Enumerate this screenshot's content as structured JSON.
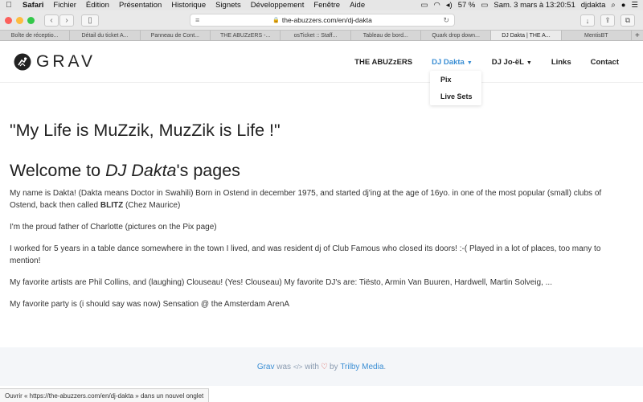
{
  "menubar": {
    "app": "Safari",
    "items": [
      "Fichier",
      "Édition",
      "Présentation",
      "Historique",
      "Signets",
      "Développement",
      "Fenêtre",
      "Aide"
    ],
    "battery": "57 %",
    "datetime": "Sam. 3 mars à  13:20:51",
    "user": "djdakta"
  },
  "browser": {
    "url": "the-abuzzers.com/en/dj-dakta",
    "tabs": [
      {
        "label": "Boîte de réceptio...",
        "active": false
      },
      {
        "label": "Détail du ticket A...",
        "active": false
      },
      {
        "label": "Panneau de Cont...",
        "active": false
      },
      {
        "label": "THE ABUZzERS -...",
        "active": false
      },
      {
        "label": "osTicket :: Staff...",
        "active": false
      },
      {
        "label": "Tableau de bord...",
        "active": false
      },
      {
        "label": "Quark drop down...",
        "active": false
      },
      {
        "label": "DJ Dakta | THE A...",
        "active": true
      },
      {
        "label": "MentisBT",
        "active": false
      }
    ],
    "status": "Ouvrir « https://the-abuzzers.com/en/dj-dakta » dans un nouvel onglet"
  },
  "site": {
    "logo": "GRAV",
    "nav": [
      {
        "label": "THE ABUZzERS",
        "active": false,
        "dropdown": false
      },
      {
        "label": "DJ Dakta",
        "active": true,
        "dropdown": true
      },
      {
        "label": "DJ Jo-ëL",
        "active": false,
        "dropdown": true
      },
      {
        "label": "Links",
        "active": false,
        "dropdown": false
      },
      {
        "label": "Contact",
        "active": false,
        "dropdown": false
      }
    ],
    "dropdown_items": [
      "Pix",
      "Live Sets"
    ]
  },
  "content": {
    "quote": "\"My Life is MuZzik, MuzZik is Life !\"",
    "welcome_prefix": "Welcome to ",
    "welcome_name": "DJ Dakta",
    "welcome_suffix": "'s pages",
    "p1_a": "My name is Dakta! (Dakta means Doctor in Swahili) Born in Ostend in december 1975, and started dj'ing at the age of 16yo. in one of the most popular (small) clubs of Ostend, back then called ",
    "p1_bold": "BLITZ",
    "p1_b": " (Chez Maurice)",
    "p2": "I'm the proud father of Charlotte (pictures on the Pix page)",
    "p3": "I worked for 5 years in a table dance somewhere in the town I lived, and was resident dj of Club Famous who closed its doors! :-( Played in a lot of places, too many to mention!",
    "p4": "My favorite artists are Phil Collins, and (laughing) Clouseau! (Yes! Clouseau) My favorite DJ's are: Tiësto, Armin Van Buuren, Hardwell, Martin Solveig, ...",
    "p5": "My favorite party is (i should say was now) Sensation @ the Amsterdam ArenA"
  },
  "footer": {
    "grav": "Grav",
    "was": "was",
    "code": "</>",
    "with": "with",
    "by": "by",
    "author": "Trilby Media",
    "period": "."
  },
  "colors": {
    "accent": "#3a8ed4",
    "heart": "#d9534f",
    "footer_bg": "#f4f6f9"
  }
}
